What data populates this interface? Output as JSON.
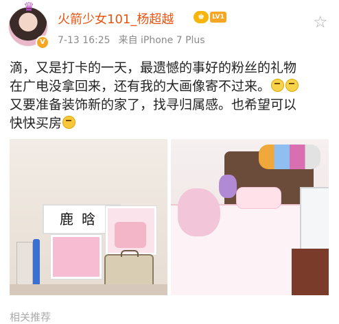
{
  "post": {
    "username": "火箭少女101_杨超越",
    "level_badge": "LV1",
    "verified_badge": "V",
    "time": "7-13 16:25",
    "source": "来自 iPhone 7 Plus",
    "text_line1": "滴，又是打卡的一天，最遗憾的事好的粉丝的礼物",
    "text_line2": "在广电没拿回来，还有我的大画像寄不过来。",
    "text_line3": "又要准备装饰新的家了，找寻归属感。也希望可以",
    "text_line4": "快快买房",
    "emoji_names": [
      "sad-face",
      "sad-face",
      "laughing-face"
    ]
  },
  "photo_left": {
    "sign_text": "鹿晗"
  },
  "footer": {
    "partial_text": "相关推荐"
  },
  "colors": {
    "username": "#e8540f",
    "meta": "#8a8a8a",
    "badge": "#f5a623"
  }
}
